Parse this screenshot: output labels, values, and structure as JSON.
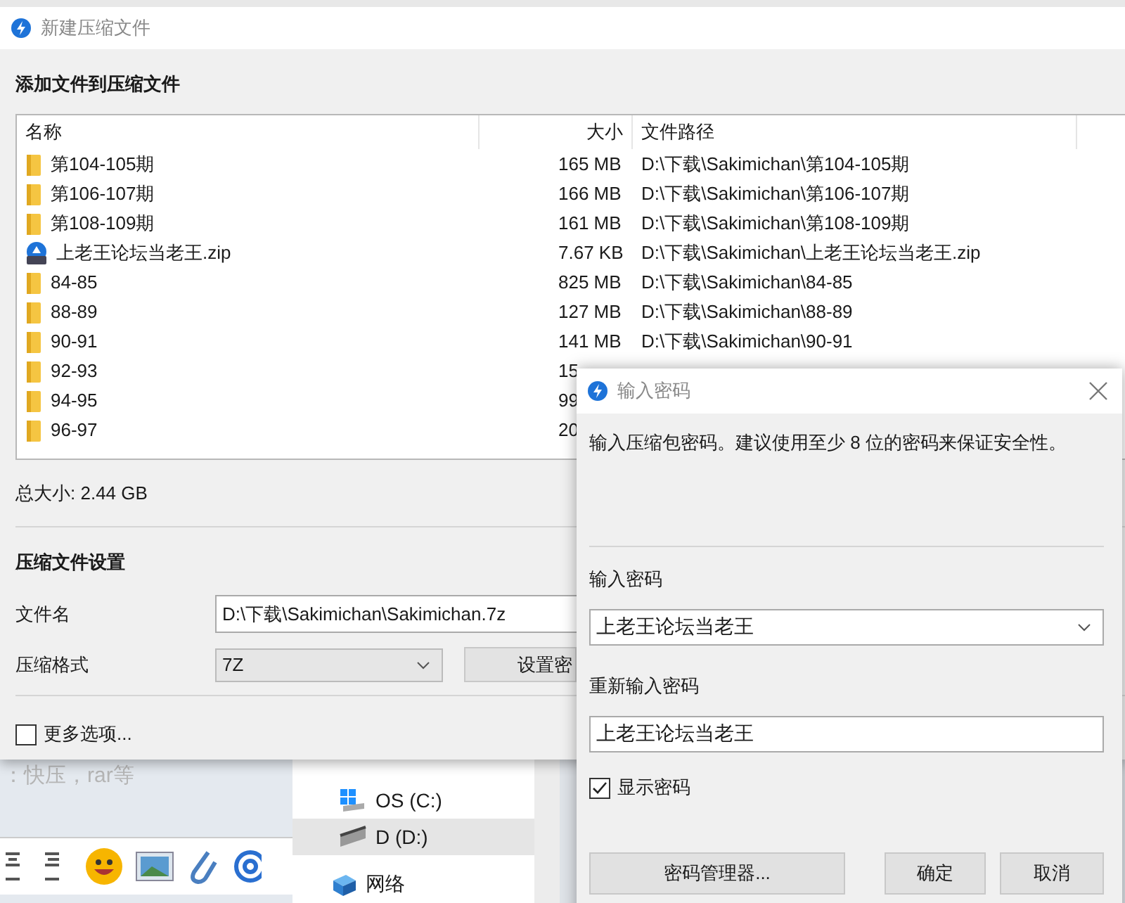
{
  "main_window": {
    "title": "新建压缩文件",
    "heading": "添加文件到压缩文件",
    "file_list": {
      "columns": [
        "名称",
        "大小",
        "文件路径"
      ],
      "rows": [
        {
          "kind": "folder",
          "name": "第104-105期",
          "size": "165 MB",
          "path": "D:\\下载\\Sakimichan\\第104-105期"
        },
        {
          "kind": "folder",
          "name": "第106-107期",
          "size": "166 MB",
          "path": "D:\\下载\\Sakimichan\\第106-107期"
        },
        {
          "kind": "folder",
          "name": "第108-109期",
          "size": "161 MB",
          "path": "D:\\下载\\Sakimichan\\第108-109期"
        },
        {
          "kind": "zip",
          "name": "上老王论坛当老王.zip",
          "size": "7.67 KB",
          "path": "D:\\下载\\Sakimichan\\上老王论坛当老王.zip"
        },
        {
          "kind": "folder",
          "name": "84-85",
          "size": "825 MB",
          "path": "D:\\下载\\Sakimichan\\84-85"
        },
        {
          "kind": "folder",
          "name": "88-89",
          "size": "127 MB",
          "path": "D:\\下载\\Sakimichan\\88-89"
        },
        {
          "kind": "folder",
          "name": "90-91",
          "size": "141 MB",
          "path": "D:\\下载\\Sakimichan\\90-91"
        },
        {
          "kind": "folder",
          "name": "92-93",
          "size": "15"
        },
        {
          "kind": "folder",
          "name": "94-95",
          "size": "99"
        },
        {
          "kind": "folder",
          "name": "96-97",
          "size": "20"
        }
      ]
    },
    "total_size": "总大小: 2.44 GB",
    "settings_heading": "压缩文件设置",
    "filename_label": "文件名",
    "filename_value": "D:\\下载\\Sakimichan\\Sakimichan.7z",
    "format_label": "压缩格式",
    "format_value": "7Z",
    "password_button": "设置密",
    "more_options": {
      "label": "更多选项...",
      "checked": false
    }
  },
  "password_dialog": {
    "title": "输入密码",
    "message": "输入压缩包密码。建议使用至少 8 位的密码来保证安全性。",
    "password_label": "输入密码",
    "password_value": "上老王论坛当老王",
    "confirm_label": "重新输入密码",
    "confirm_value": "上老王论坛当老王",
    "show_password": {
      "label": "显示密码",
      "checked": true
    },
    "buttons": [
      "密码管理器...",
      "确定",
      "取消"
    ]
  },
  "background": {
    "editor_text": "：快压，rar等",
    "explorer_items": [
      {
        "kind": "windows-drive",
        "label": "OS (C:)",
        "selected": false
      },
      {
        "kind": "drive",
        "label": "D (D:)",
        "selected": true
      },
      {
        "kind": "network",
        "label": "网络",
        "selected": false
      }
    ]
  }
}
